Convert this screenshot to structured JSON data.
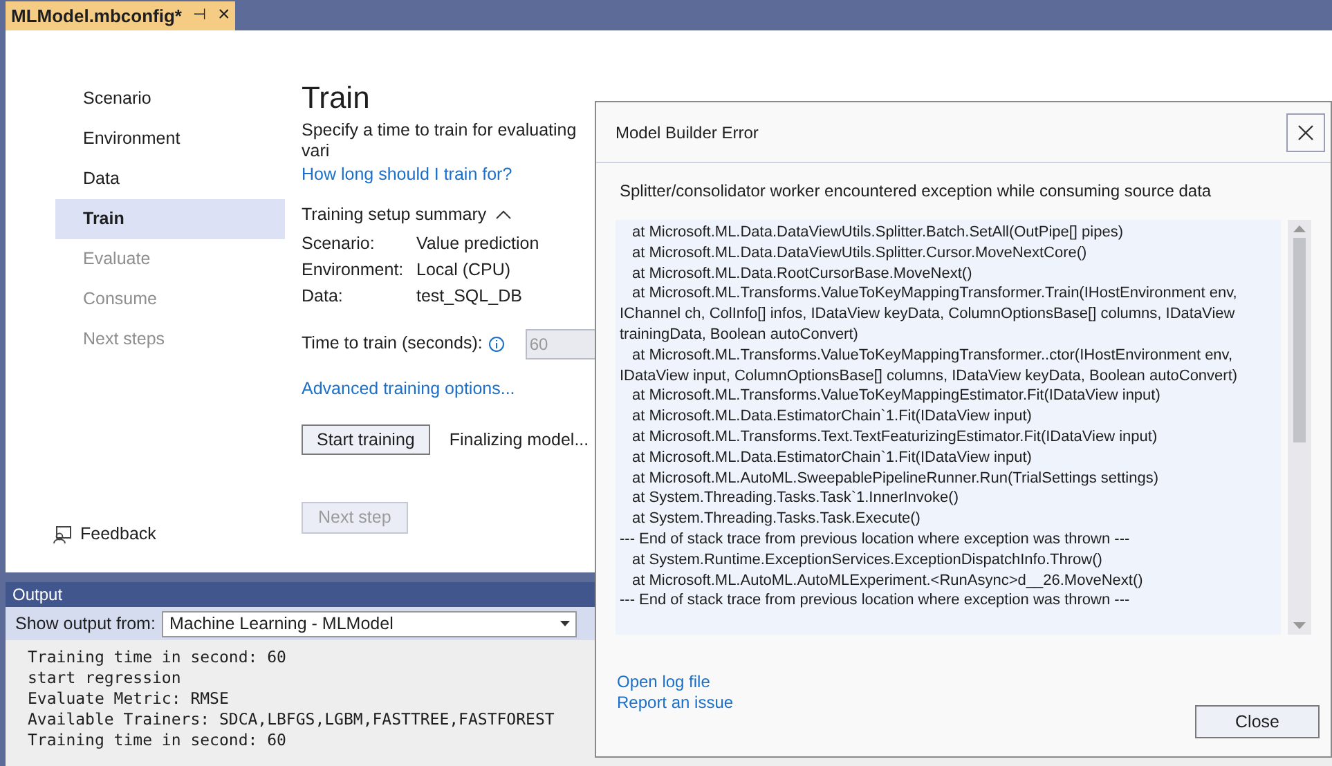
{
  "document_tab": {
    "title": "MLModel.mbconfig*",
    "pin": "⊣",
    "close": "×"
  },
  "steps": [
    {
      "label": "Scenario",
      "selected": false,
      "disabled": false
    },
    {
      "label": "Environment",
      "selected": false,
      "disabled": false
    },
    {
      "label": "Data",
      "selected": false,
      "disabled": false
    },
    {
      "label": "Train",
      "selected": true,
      "disabled": false
    },
    {
      "label": "Evaluate",
      "selected": false,
      "disabled": true
    },
    {
      "label": "Consume",
      "selected": false,
      "disabled": true
    },
    {
      "label": "Next steps",
      "selected": false,
      "disabled": true
    }
  ],
  "feedback": "Feedback",
  "page": {
    "title": "Train",
    "description": "Specify a time to train for evaluating vari",
    "help_link": "How long should I train for?",
    "summary": {
      "title": "Training setup summary",
      "expanded": true,
      "rows": [
        {
          "label": "Scenario:",
          "value": "Value prediction"
        },
        {
          "label": "Environment:",
          "value": "Local (CPU)"
        },
        {
          "label": "Data:",
          "value": "test_SQL_DB"
        }
      ]
    },
    "time_label": "Time to train (seconds):",
    "time_value": "60",
    "advanced_link": "Advanced training options...",
    "start_button": "Start training",
    "status": "Finalizing model...",
    "next_button": {
      "label": "Next step",
      "disabled": true
    }
  },
  "output": {
    "title": "Output",
    "source_label": "Show output from:",
    "source_value": "Machine Learning - MLModel",
    "lines": [
      "Training time in second: 60",
      "start regression",
      "Evaluate Metric: RMSE",
      "Available Trainers: SDCA,LBFGS,LGBM,FASTTREE,FASTFOREST",
      "Training time in second: 60"
    ]
  },
  "dialog": {
    "title": "Model Builder Error",
    "message": "Splitter/consolidator worker encountered exception while consuming source data",
    "trace": [
      {
        "kind": "frame",
        "text": "at Microsoft.ML.Data.DataViewUtils.Splitter.Batch.SetAll(OutPipe[] pipes)"
      },
      {
        "kind": "frame",
        "text": "at Microsoft.ML.Data.DataViewUtils.Splitter.Cursor.MoveNextCore()"
      },
      {
        "kind": "frame",
        "text": "at Microsoft.ML.Data.RootCursorBase.MoveNext()"
      },
      {
        "kind": "frame",
        "text": "at Microsoft.ML.Transforms.ValueToKeyMappingTransformer.Train(IHostEnvironment env, IChannel ch, ColInfo[] infos, IDataView keyData, ColumnOptionsBase[] columns, IDataView trainingData, Boolean autoConvert)"
      },
      {
        "kind": "frame",
        "text": "at Microsoft.ML.Transforms.ValueToKeyMappingTransformer..ctor(IHostEnvironment env, IDataView input, ColumnOptionsBase[] columns, IDataView keyData, Boolean autoConvert)"
      },
      {
        "kind": "frame",
        "text": "at Microsoft.ML.Transforms.ValueToKeyMappingEstimator.Fit(IDataView input)"
      },
      {
        "kind": "frame",
        "text": "at Microsoft.ML.Data.EstimatorChain`1.Fit(IDataView input)"
      },
      {
        "kind": "frame",
        "text": "at Microsoft.ML.Transforms.Text.TextFeaturizingEstimator.Fit(IDataView input)"
      },
      {
        "kind": "frame",
        "text": "at Microsoft.ML.Data.EstimatorChain`1.Fit(IDataView input)"
      },
      {
        "kind": "frame",
        "text": "at Microsoft.ML.AutoML.SweepablePipelineRunner.Run(TrialSettings settings)"
      },
      {
        "kind": "frame",
        "text": "at System.Threading.Tasks.Task`1.InnerInvoke()"
      },
      {
        "kind": "frame",
        "text": "at System.Threading.Tasks.Task.Execute()"
      },
      {
        "kind": "separator",
        "text": "--- End of stack trace from previous location where exception was thrown ---"
      },
      {
        "kind": "frame",
        "text": "at System.Runtime.ExceptionServices.ExceptionDispatchInfo.Throw()"
      },
      {
        "kind": "frame",
        "text": "at Microsoft.ML.AutoML.AutoMLExperiment.<RunAsync>d__26.MoveNext()"
      },
      {
        "kind": "separator",
        "text": "--- End of stack trace from previous location where exception was thrown ---"
      }
    ],
    "links": [
      "Open log file",
      "Report an issue"
    ],
    "close_button": "Close"
  }
}
